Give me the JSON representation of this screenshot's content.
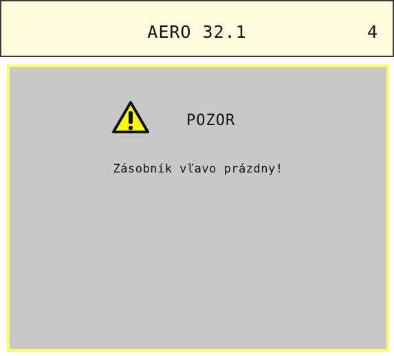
{
  "header": {
    "title": "AERO 32.1",
    "page_number": "4",
    "background_color": "#fffde0"
  },
  "alarm": {
    "icon": "warning-triangle-icon",
    "title": "POZOR",
    "message": "Zásobník vľavo prázdny!",
    "background_color": "#c8c8c8",
    "border_color": "#ffff66",
    "icon_color": "#ffff00"
  }
}
